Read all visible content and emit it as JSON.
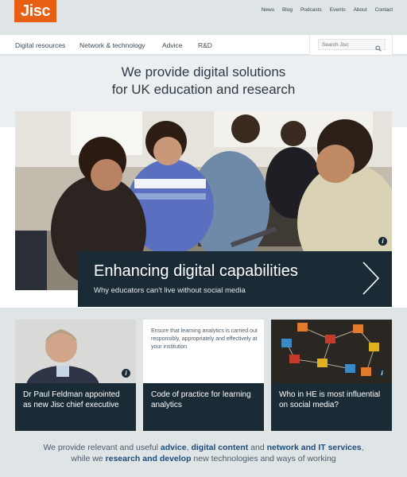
{
  "brand": {
    "logo_text": "Jisc",
    "accent_color": "#e85e13",
    "dark_color": "#1b2b36"
  },
  "top_nav": [
    "News",
    "Blog",
    "Podcasts",
    "Events",
    "About",
    "Contact"
  ],
  "main_nav": [
    "Digital resources",
    "Network & technology",
    "Advice",
    "R&D"
  ],
  "search": {
    "placeholder": "Search Jisc",
    "icon": "search-icon"
  },
  "hero": {
    "title_line1": "We provide digital solutions",
    "title_line2": "for UK education and research",
    "caption_title": "Enhancing digital capabilities",
    "caption_subtitle": "Why educators can't live without social media",
    "info_icon": "i"
  },
  "cards": [
    {
      "title": "Dr Paul Feldman appointed as new Jisc chief executive",
      "info_icon": "i"
    },
    {
      "excerpt": "Ensure that learning analytics is carried out responsibly, appropriately and effectively at your institution",
      "title": "Code of practice for learning analytics"
    },
    {
      "title": "Who in HE is most influential on social media?",
      "info_icon": "i"
    }
  ],
  "footer": {
    "t1": "We provide relevant and useful ",
    "l1": "advice",
    "t2": ", ",
    "l2": "digital content",
    "t3": " and ",
    "l3": "network and IT services",
    "t4": ",",
    "t5": "while we ",
    "l4": "research and develop",
    "t6": " new technologies and ways of working"
  }
}
